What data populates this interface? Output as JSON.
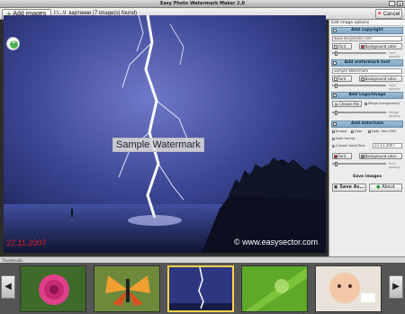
{
  "window": {
    "title": "Easy Photo Watermark Maker 2.0"
  },
  "toolbar": {
    "add_images_label": "Add images",
    "folder_label": "I:\\...\\!_картинки (7 image(s) found)",
    "cancel_label": "Cancel"
  },
  "preview": {
    "watermark_text": "Sample Watermark",
    "date_stamp": "22.11.2007",
    "copyright_stamp": "© www.easysector.com",
    "logo_letter": "S"
  },
  "panel": {
    "title": "Edit image options",
    "copyright": {
      "header": "Add copyright",
      "value": "www.easysector.com",
      "font_label": "Font",
      "bg_label": "Background color",
      "slider_label": "Font opacity"
    },
    "watermark": {
      "header": "Add watermark text",
      "value": "Sample Watermark",
      "font_label": "Font",
      "bg_label": "Background color",
      "slider_label": "Font opacity"
    },
    "logo": {
      "header": "Add Logo/Image",
      "choose_label": "Choose file",
      "transparency_label": "Merge transparency",
      "slider_label": "Image opacity"
    },
    "datetime": {
      "header": "Add date/time",
      "opt_embed": "Embed",
      "opt_date": "Date",
      "opt_exif": "Date, from EXIF",
      "opt_date_format": "Date format",
      "opt_custom": "Custom Date/Time",
      "custom_value": "22.11.2007",
      "font_label": "Font",
      "bg_label": "Background color",
      "slider_label": "Font opacity"
    },
    "save": {
      "header": "Save images",
      "save_label": "Save As...",
      "about_label": "About"
    }
  },
  "thumbnails": {
    "label": "Thumbnails"
  },
  "colors": {
    "accent": "#7ea6c4",
    "cancel": "#d22222",
    "date_stamp": "#e01a1a"
  }
}
